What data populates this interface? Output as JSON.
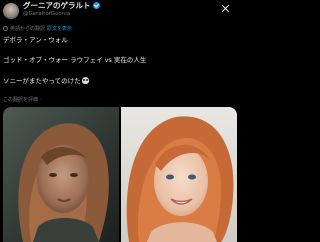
{
  "post": {
    "display_name": "グーニアのゲラルト",
    "handle": "@GeraltofGoonia",
    "translation_note": "英語からの翻訳",
    "original_link": "原文を表示",
    "lines": [
      "デボラ・アン・ウォル",
      "ゴッド・オブ・ウォー ラウフェイ vs 実在の人生",
      "ソニーがまたやってのけた"
    ],
    "emoji_icon": "skull-icon",
    "rate_label": "この翻訳を評価",
    "rate_separator": "·"
  },
  "colors": {
    "background": "#000000",
    "text": "#e7e9ea",
    "muted": "#71767b",
    "accent": "#1d9bf0"
  },
  "media": {
    "images": [
      "left-photo",
      "right-photo"
    ]
  }
}
